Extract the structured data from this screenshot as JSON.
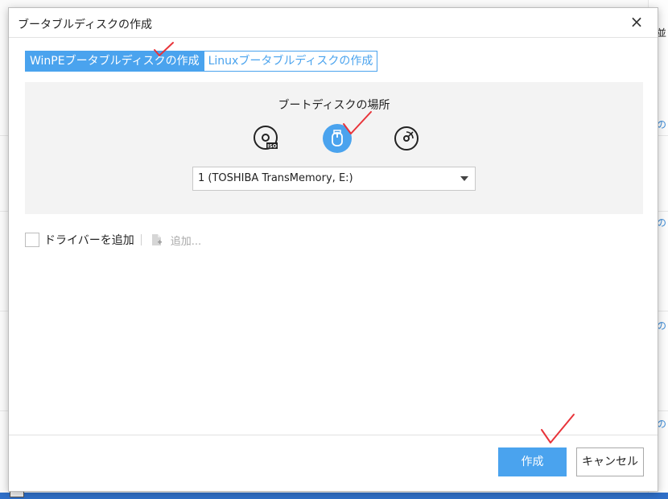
{
  "dialog": {
    "title": "ブータブルディスクの作成",
    "close_label": "×"
  },
  "tabs": [
    {
      "label": "WinPEブータブルディスクの作成",
      "active": true
    },
    {
      "label": "Linuxブータブルディスクの作成",
      "active": false
    }
  ],
  "boot_location": {
    "label": "ブートディスクの場所",
    "media_icons": [
      "iso-disc-icon",
      "usb-drive-icon",
      "cd-dvd-icon"
    ],
    "selected_media": "usb-drive-icon",
    "device_select_value": "1 (TOSHIBA TransMemory, E:)"
  },
  "driver": {
    "checkbox_label": "ドライバーを追加",
    "checked": false,
    "add_label": "追加..."
  },
  "buttons": {
    "create": "作成",
    "cancel": "キャンセル"
  },
  "background": {
    "right_edge_glyphs": [
      "並",
      "の",
      "の",
      "の",
      "の",
      "の"
    ]
  },
  "colors": {
    "accent": "#4aa3ee",
    "annotation_check": "#e8343a"
  }
}
